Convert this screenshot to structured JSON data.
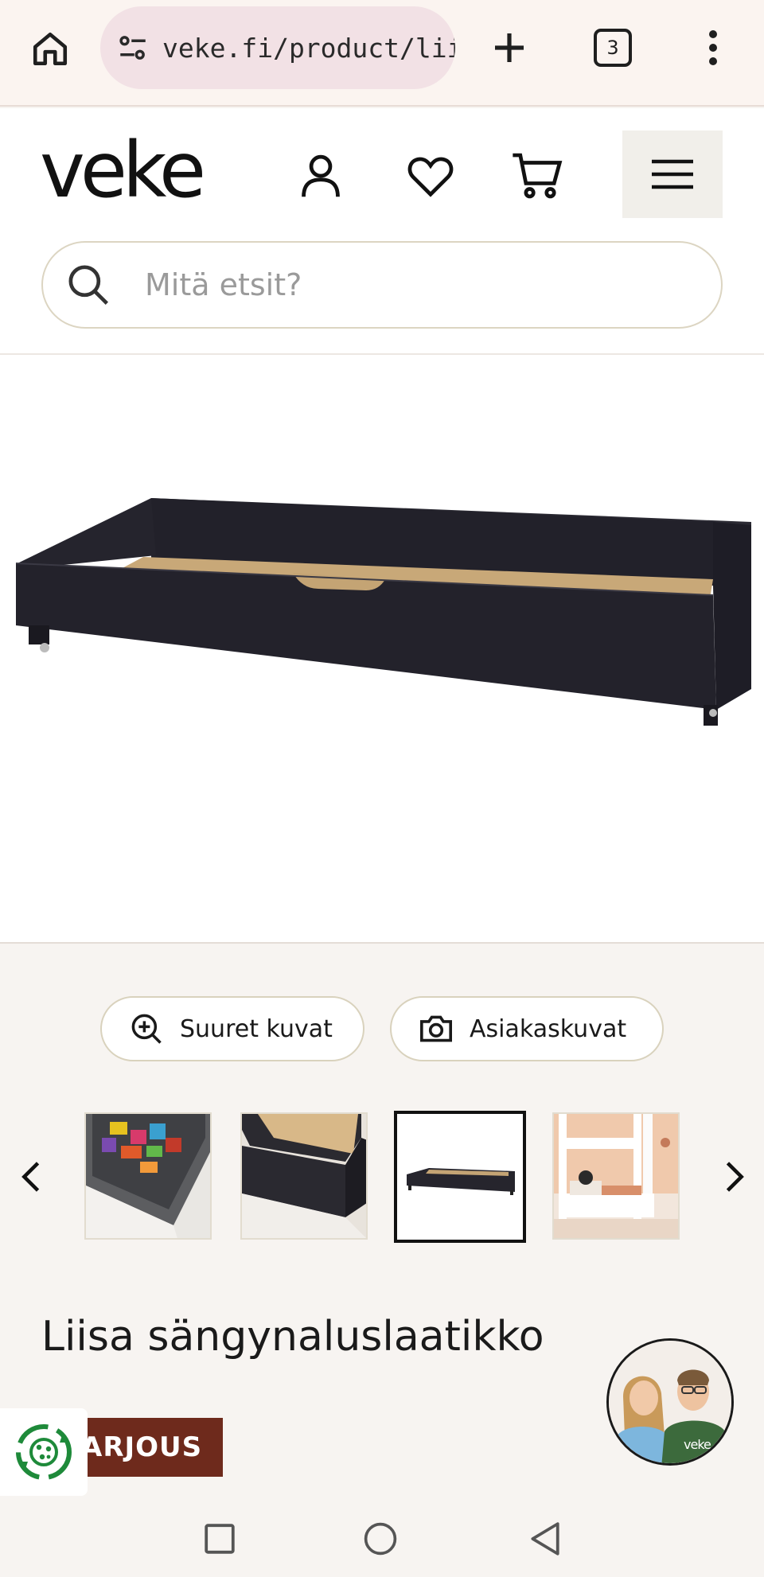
{
  "browser": {
    "url": "veke.fi/product/liis",
    "tab_count": "3"
  },
  "header": {
    "logo": "veke"
  },
  "search": {
    "placeholder": "Mitä etsit?"
  },
  "gallery": {
    "large_images_label": "Suuret kuvat",
    "customer_images_label": "Asiakaskuvat",
    "thumbnails": [
      {
        "name": "thumb-toys"
      },
      {
        "name": "thumb-drawer-closeup"
      },
      {
        "name": "thumb-drawer-black"
      },
      {
        "name": "thumb-bunk-bed"
      }
    ],
    "active_thumbnail": 3
  },
  "product": {
    "title": "Liisa sängynaluslaatikko",
    "badge": "ARJOUS"
  },
  "colors": {
    "brand_red": "#6e2a1c",
    "eco_green": "#1e8a3a"
  }
}
